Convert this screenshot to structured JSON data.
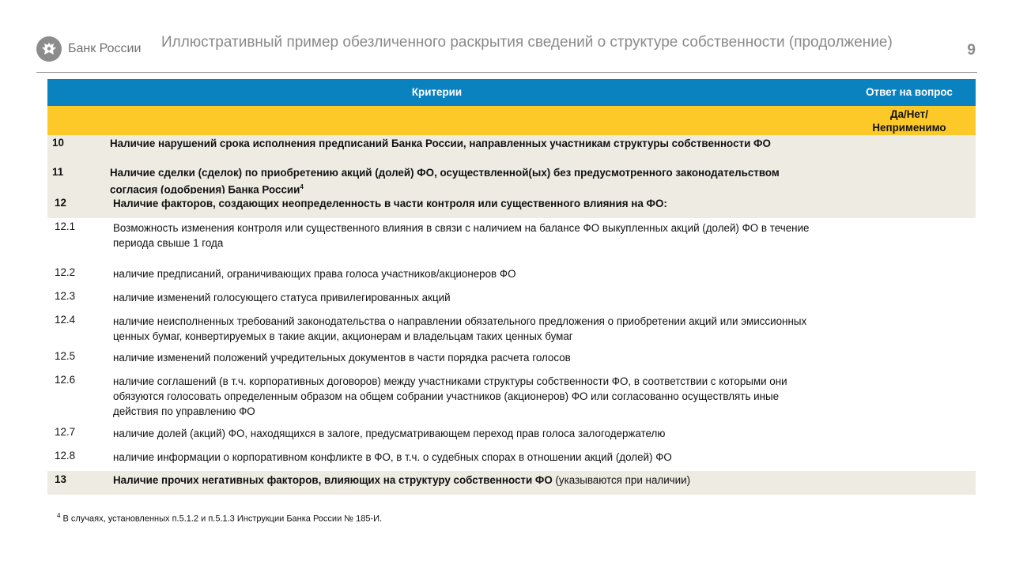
{
  "header": {
    "logo_text": "Банк России",
    "title": "Иллюстративный пример обезличенного раскрытия сведений о структуре собственности (продолжение)",
    "page_number": "9"
  },
  "table": {
    "col_criteria": "Критерии",
    "col_answer": "Ответ на вопрос",
    "answer_options_line1": "Да/Нет/",
    "answer_options_line2": "Неприменимо",
    "rows": [
      {
        "num": "10",
        "text": "Наличие нарушений срока исполнения предписаний Банка России, направленных участникам структуры собственности ФО"
      },
      {
        "num": "11",
        "text": "Наличие сделки (сделок) по приобретению акций (долей) ФО, осуществленной(ых) без предусмотренного законодательством согласия (одобрения) Банка России",
        "sup": "4"
      },
      {
        "num": "12",
        "text": "Наличие факторов, создающих неопределенность в части контроля или существенного влияния на ФО:"
      }
    ],
    "subrows": [
      {
        "num": "12.1",
        "text": "Возможность изменения контроля или существенного влияния в связи с наличием на балансе ФО выкупленных акций (долей) ФО в течение периода свыше 1 года"
      },
      {
        "num": "12.2",
        "text": "наличие предписаний, ограничивающих права голоса участников/акционеров ФО"
      },
      {
        "num": "12.3",
        "text": "наличие изменений голосующего статуса привилегированных акций"
      },
      {
        "num": "12.4",
        "text": "наличие неисполненных требований законодательства о направлении обязательного предложения о приобретении акций или эмиссионных ценных бумаг, конвертируемых в такие акции, акционерам и владельцам таких ценных бумаг"
      },
      {
        "num": "12.5",
        "text": "наличие изменений положений учредительных документов в части порядка расчета голосов"
      },
      {
        "num": "12.6",
        "text": "наличие соглашений (в т.ч. корпоративных договоров) между участниками структуры собственности ФО, в соответствии с которыми они обязуются голосовать определенным образом на общем собрании участников (акционеров) ФО или согласованно осуществлять иные действия по управлению ФО"
      },
      {
        "num": "12.7",
        "text": "наличие долей (акций) ФО, находящихся в залоге, предусматривающем переход прав голоса залогодержателю"
      },
      {
        "num": "12.8",
        "text": "наличие информации о корпоративном конфликте в ФО, в т.ч. о судебных спорах в отношении акций (долей) ФО"
      }
    ],
    "last_row": {
      "num": "13",
      "text_bold": "Наличие прочих негативных факторов, влияющих на структуру собственности ФО",
      "text_normal": " (указываются при наличии)"
    }
  },
  "footnote": {
    "mark": "4",
    "text": " В случаях, установленных п.5.1.2 и п.5.1.3 Инструкции Банка России № 185-И."
  }
}
